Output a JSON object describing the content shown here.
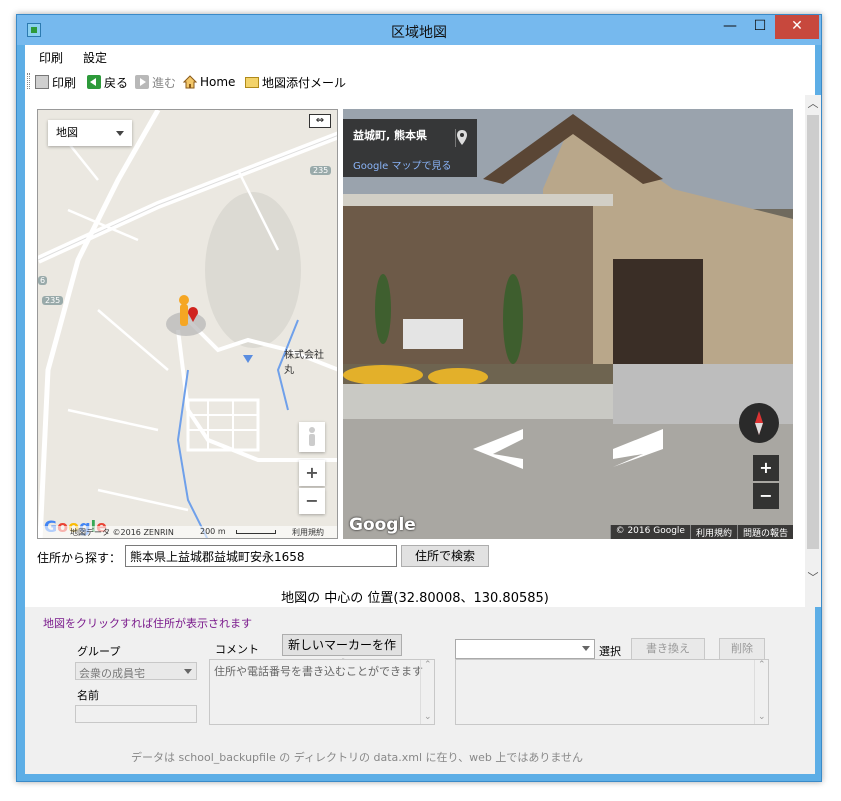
{
  "window": {
    "title": "区域地図"
  },
  "menu": {
    "print": "印刷",
    "settings": "設定"
  },
  "toolbar": {
    "print": "印刷",
    "back": "戻る",
    "forward": "進む",
    "home": "Home",
    "mail": "地図添付メール"
  },
  "map": {
    "type_label": "地図",
    "road_badge_1": "235",
    "road_badge_2": "235",
    "road_badge_3": "6",
    "company_label": "株式会社 丸",
    "attribution": "地図データ ©2016 ZENRIN",
    "scale": "200 m",
    "terms": "利用規約",
    "zoom_in": "+",
    "zoom_out": "−",
    "logo": [
      "G",
      "o",
      "o",
      "g",
      "l",
      "e"
    ]
  },
  "streetview": {
    "place": "益城町, 熊本県",
    "maps_link": "Google マップで見る",
    "copyright": "© 2016 Google",
    "terms": "利用規約",
    "report": "問題の報告",
    "logo": "Google",
    "zoom_in": "+",
    "zoom_out": "−"
  },
  "search": {
    "label": "住所から探す：",
    "value": "熊本県上益城郡益城町安永1658",
    "button": "住所で検索"
  },
  "center_position": "地図の 中心の 位置(32.80008、130.80585)",
  "lower": {
    "hint": "地図をクリックすれば住所が表示されます",
    "group_label": "グループ",
    "group_value": "会衆の成員宅",
    "comment_label": "コメント",
    "new_marker_button": "新しいマーカーを作成",
    "comment_text": "住所や電話番号を書き込むことができます",
    "name_label": "名前",
    "name_value": "",
    "select_value": "",
    "select_label": "選択",
    "rewrite_button": "書き換え",
    "delete_button": "削除",
    "data_note": "データは school_backupfile の ディレクトリの data.xml に在り、web 上ではありません"
  },
  "colors": {
    "title_bar": "#76b9ee",
    "close": "#c7483d",
    "hint_text": "#7a1a8c"
  }
}
